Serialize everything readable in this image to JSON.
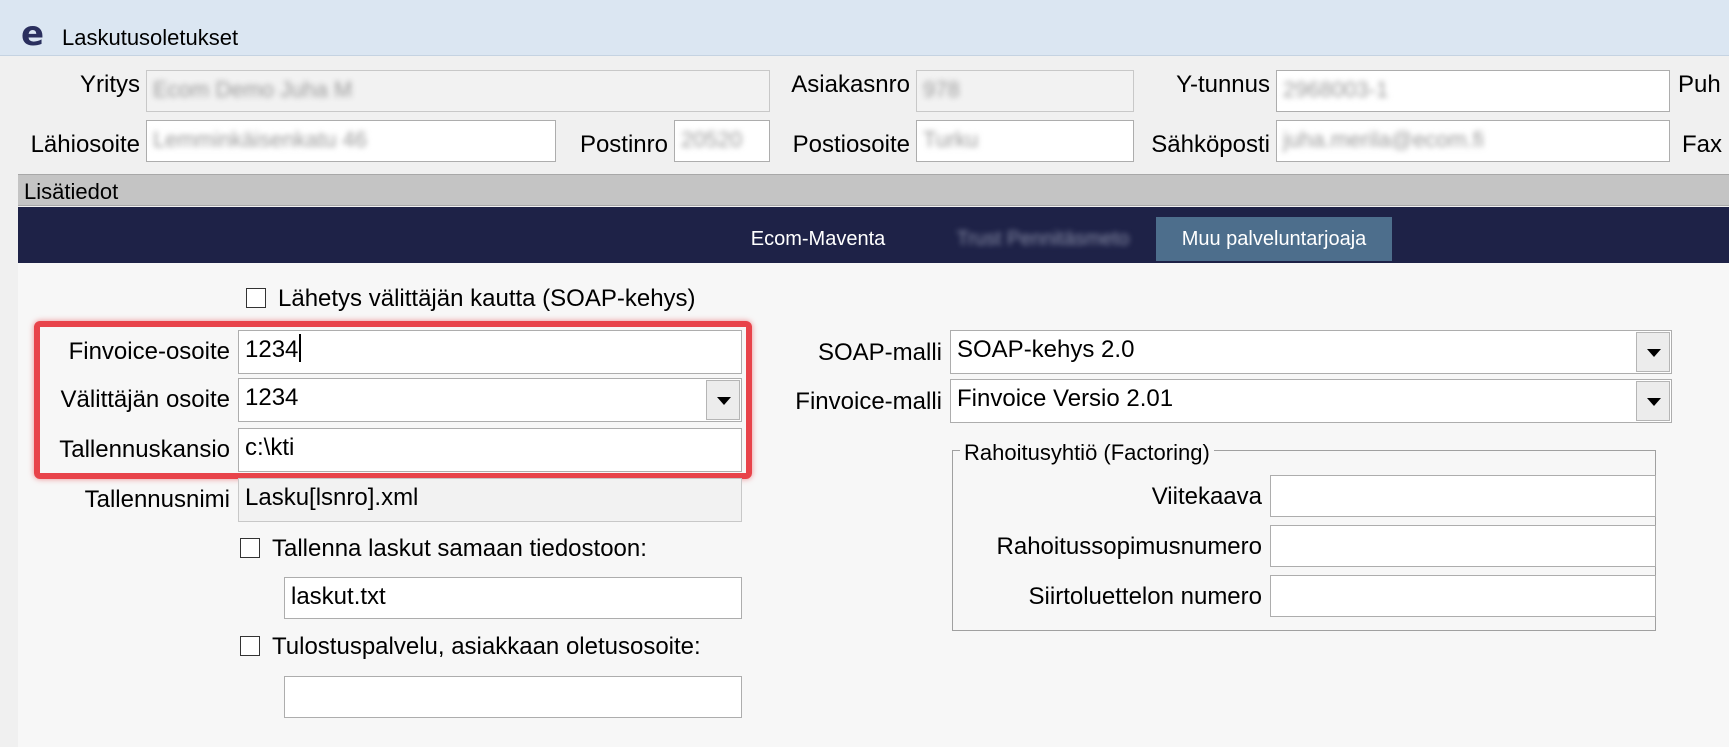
{
  "window": {
    "title": "Laskutusoletukset",
    "logo_letter": "e"
  },
  "company": {
    "yritys_label": "Yritys",
    "yritys_value": "Ecom Demo Juha M",
    "asiakasnro_label": "Asiakasnro",
    "asiakasnro_value": "978",
    "ytunnus_label": "Y-tunnus",
    "ytunnus_value": "2968003-1",
    "puh_label": "Puh",
    "lahiosoite_label": "Lähiosoite",
    "lahiosoite_value": "Lemminkäisenkatu 46",
    "postinro_label": "Postinro",
    "postinro_value": "20520",
    "postiosoite_label": "Postiosoite",
    "postiosoite_value": "Turku",
    "sahkoposti_label": "Sähköposti",
    "sahkoposti_value": "juha.merila@ecom.fi",
    "fax_label": "Fax"
  },
  "section": {
    "title": "Lisätiedot"
  },
  "tabs": [
    {
      "label": "Ecom-Maventa"
    },
    {
      "label": "Trust Pennitäsmeto"
    },
    {
      "label": "Muu palveluntarjoaja"
    }
  ],
  "form": {
    "soap_checkbox_label": "Lähetys välittäjän kautta (SOAP-kehys)",
    "finvoice_osoite_label": "Finvoice-osoite",
    "finvoice_osoite_value": "1234",
    "valittajan_osoite_label": "Välittäjän osoite",
    "valittajan_osoite_value": "1234",
    "tallennuskansio_label": "Tallennuskansio",
    "tallennuskansio_value": "c:\\kti",
    "tallennusnimi_label": "Tallennusnimi",
    "tallennusnimi_value": "Lasku[lsnro].xml",
    "samaan_checkbox_label": "Tallenna laskut samaan tiedostoon:",
    "samaan_value": "laskut.txt",
    "tulostus_checkbox_label": "Tulostuspalvelu, asiakkaan oletusosoite:",
    "tulostus_value": "",
    "soap_malli_label": "SOAP-malli",
    "soap_malli_value": "SOAP-kehys 2.0",
    "finvoice_malli_label": "Finvoice-malli",
    "finvoice_malli_value": "Finvoice Versio 2.01"
  },
  "factoring": {
    "title": "Rahoitusyhtiö (Factoring)",
    "viitekaava_label": "Viitekaava",
    "viitekaava_value": "",
    "rahoitussopimus_label": "Rahoitussopimusnumero",
    "rahoitussopimus_value": "",
    "siirtoluettelo_label": "Siirtoluettelon numero",
    "siirtoluettelo_value": ""
  },
  "colors": {
    "highlight": "#e8434a",
    "tabbar": "#1e2247",
    "active_tab": "#4d6e8c"
  }
}
